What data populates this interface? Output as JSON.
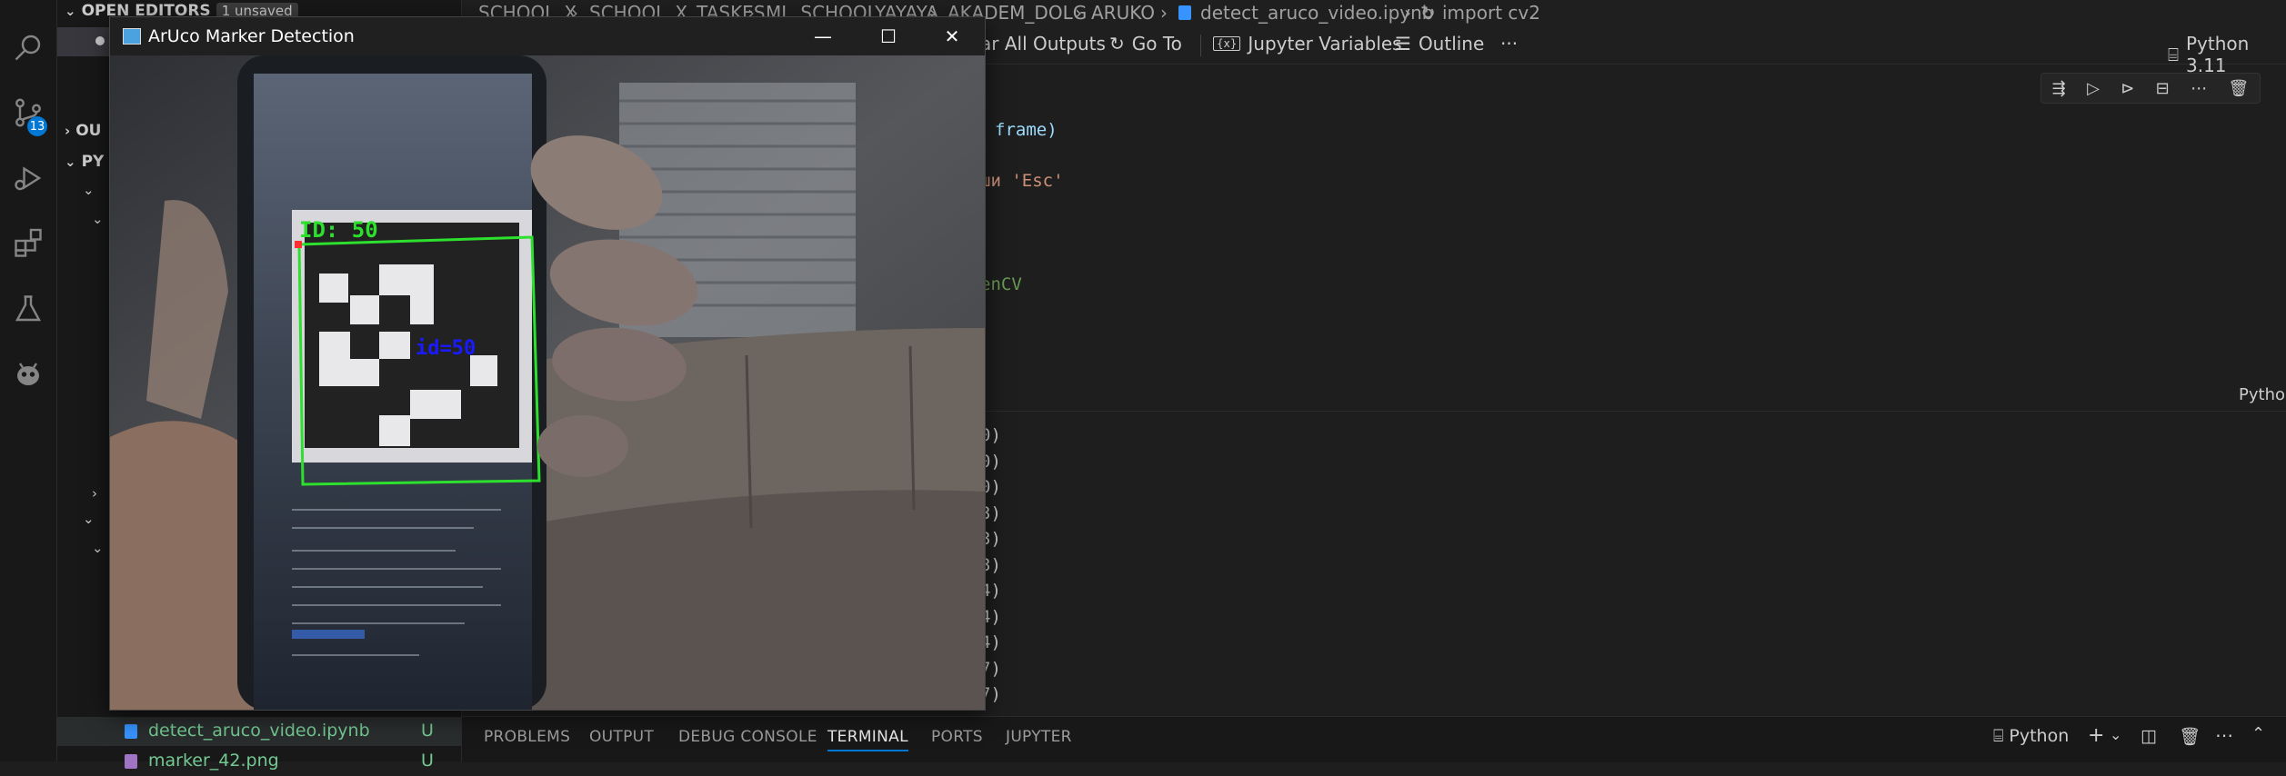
{
  "sidebar": {
    "open_editors": {
      "title": "OPEN EDITORS",
      "unsaved": "1 unsaved"
    },
    "outline_title": "OU",
    "python_title": "PY",
    "badge_count": "13",
    "files": [
      {
        "name": "detect_aruco_video.ipynb",
        "status": "U"
      },
      {
        "name": "marker_42.png",
        "status": "U"
      }
    ]
  },
  "breadcrumb": [
    "SCHOOL_X",
    "SCHOOL_X_TASKES",
    "ML_SCHOOLYAYAYA",
    "AKADEM_DOLG",
    "ARUKO",
    "detect_aruco_video.ipynb",
    "import cv2"
  ],
  "toolbar": {
    "clear_outputs": "ar All Outputs",
    "go_to": "Go To",
    "jupyter_variables": "Jupyter Variables",
    "outline": "Outline",
    "kernel": "Python 3.11"
  },
  "code": {
    "line1": "frame)",
    "line2": "ши 'Esc'",
    "line3": "enCV"
  },
  "cell_lang": "Pytho",
  "output_lines": [
    "0)",
    "0)",
    "0)",
    "3)",
    "3)",
    "3)",
    "4)",
    "4)",
    "4)",
    "7)",
    "7)"
  ],
  "panel": {
    "tabs": [
      "PROBLEMS",
      "OUTPUT",
      "DEBUG CONSOLE",
      "TERMINAL",
      "PORTS",
      "JUPYTER"
    ],
    "active_tab": "TERMINAL",
    "terminal_name": "Python"
  },
  "popup": {
    "title": "ArUco Marker Detection",
    "detected_label": "ID: 50",
    "center_label": "id=50"
  },
  "colors": {
    "accent": "#0078d4",
    "marker_outline": "#2ee02e",
    "id_label": "#1a1aff",
    "untracked": "#73c991"
  }
}
